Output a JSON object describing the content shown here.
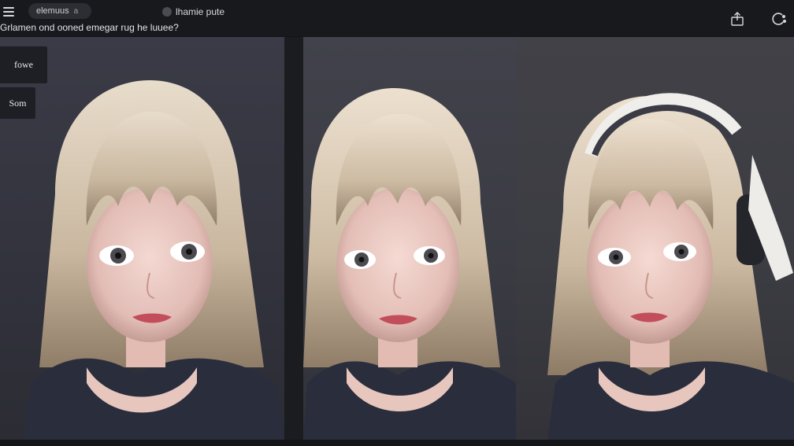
{
  "topbar": {
    "pill_label": "elemuus",
    "pill_sub": "a",
    "model_label": "lhamie pute",
    "prompt": "Grlamen ond ooned emegar rug he luuee?"
  },
  "sidebar": {
    "view_label": "fowe",
    "save_label": "Som"
  },
  "images": [
    {
      "alt": "portrait-1"
    },
    {
      "alt": "portrait-2"
    },
    {
      "alt": "portrait-3-with-headphones"
    }
  ]
}
